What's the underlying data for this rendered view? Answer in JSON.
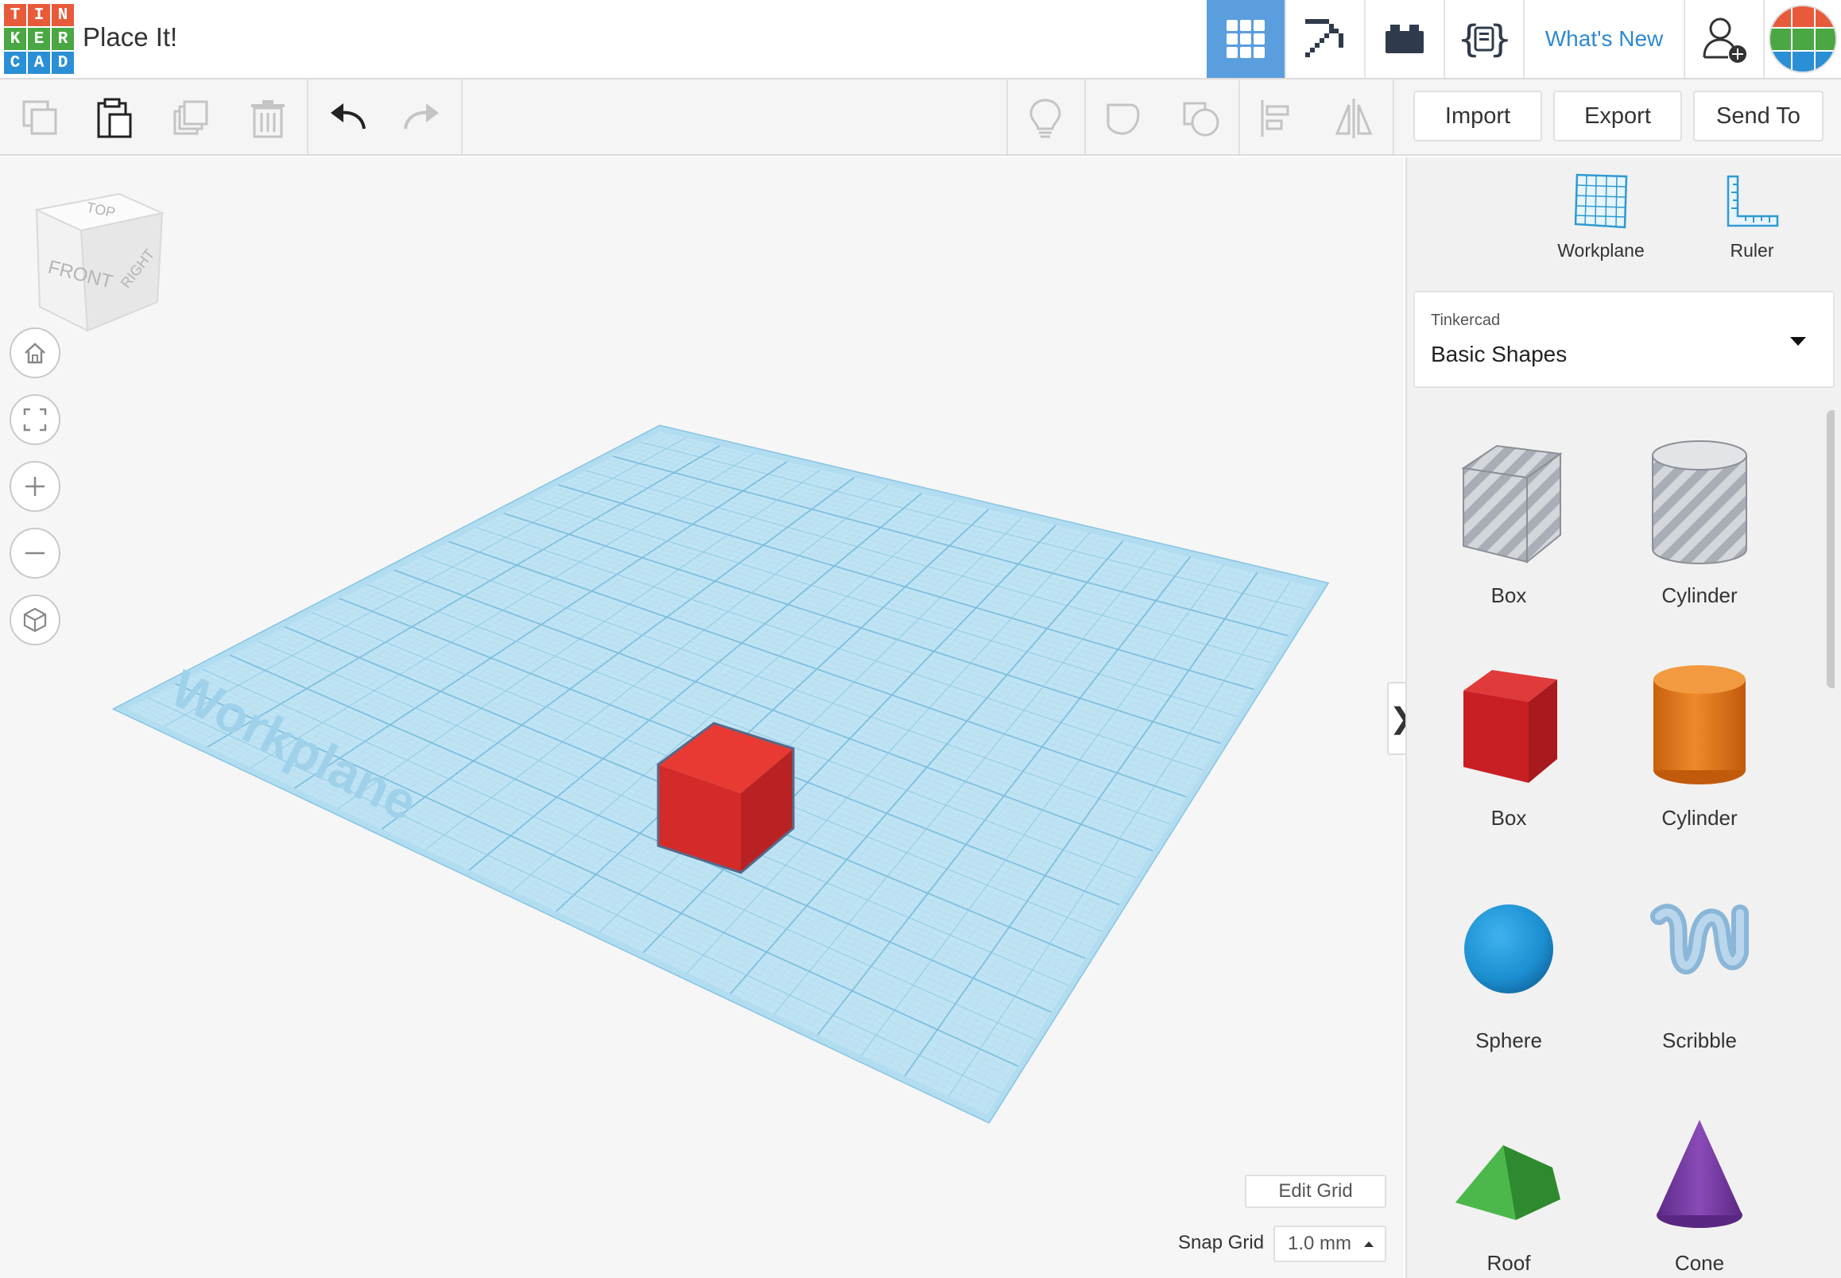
{
  "header": {
    "logo_letters": [
      "T",
      "I",
      "N",
      "K",
      "E",
      "R",
      "C",
      "A",
      "D"
    ],
    "logo_colors": [
      "#e85b3a",
      "#e85b3a",
      "#e85b3a",
      "#4aa743",
      "#4aa743",
      "#4aa743",
      "#2b8fd6",
      "#2b8fd6",
      "#2b8fd6"
    ],
    "project_title": "Place It!",
    "whats_new": "What's New",
    "icons": [
      "grid-view-icon",
      "pickaxe-icon",
      "bricks-icon",
      "codeblocks-icon",
      "add-user-icon",
      "avatar"
    ]
  },
  "toolbar": {
    "left_icons": [
      "copy-icon",
      "paste-icon",
      "duplicate-icon",
      "delete-icon",
      "undo-icon",
      "redo-icon"
    ],
    "right_icons": [
      "notes-icon",
      "group-icon",
      "ungroup-icon",
      "align-icon",
      "mirror-icon"
    ],
    "import_label": "Import",
    "export_label": "Export",
    "send_to_label": "Send To"
  },
  "viewcube": {
    "top": "TOP",
    "front": "FRONT",
    "right": "RIGHT"
  },
  "viewport": {
    "workplane_label": "Workplane",
    "edit_grid_label": "Edit Grid",
    "snap_grid_label": "Snap Grid",
    "snap_grid_value": "1.0 mm"
  },
  "panel": {
    "workplane_label": "Workplane",
    "ruler_label": "Ruler",
    "library_provider": "Tinkercad",
    "library_category": "Basic Shapes",
    "shapes": [
      {
        "label": "Box"
      },
      {
        "label": "Cylinder"
      },
      {
        "label": "Box"
      },
      {
        "label": "Cylinder"
      },
      {
        "label": "Sphere"
      },
      {
        "label": "Scribble"
      },
      {
        "label": "Roof"
      },
      {
        "label": "Cone"
      }
    ]
  },
  "colors": {
    "accent_blue": "#5a9ede",
    "workplane_blue": "#bfe3f3",
    "box_red": "#d42a2a",
    "cylinder_orange": "#e07a1f",
    "sphere_blue": "#1c8fd1",
    "roof_green": "#3aa33a",
    "cone_purple": "#7a3fa3"
  }
}
